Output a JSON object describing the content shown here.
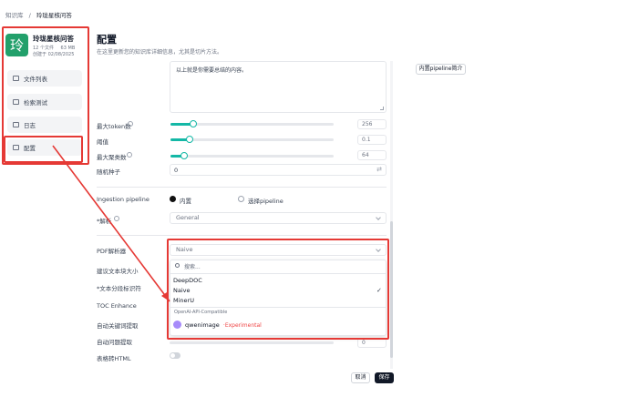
{
  "breadcrumb": {
    "root": "知识库",
    "sep": "/",
    "current": "玲珑星核问答"
  },
  "kb": {
    "avatar_char": "玲",
    "name": "玲珑星核问答",
    "meta1": "12 个文件",
    "meta2": "63 MB",
    "created": "创建于 02/08/2025",
    "avatar_color": "#22a06b"
  },
  "sidebar": {
    "items": [
      {
        "label": "文件列表"
      },
      {
        "label": "检索测试"
      },
      {
        "label": "日志"
      },
      {
        "label": "配置"
      }
    ]
  },
  "header": {
    "title": "配置",
    "subtitle": "在这里更新您的知识库详细信息，尤其是切片方法。"
  },
  "textarea": {
    "value": "以上就是你需要总结的内容。"
  },
  "pipeline_intro_button": "内置pipeline简介",
  "params": {
    "max_token_label": "最大token数",
    "max_token_value": "256",
    "threshold_label": "阈值",
    "threshold_value": "0.1",
    "max_clusters_label": "最大聚类数",
    "max_clusters_value": "64",
    "random_seed_label": "随机种子",
    "random_seed_value": "0"
  },
  "ingestion": {
    "label": "Ingestion pipeline",
    "opt_builtin": "内置",
    "opt_choose": "选择pipeline"
  },
  "parse_method": {
    "label": "*解析",
    "value": "General"
  },
  "pdf_parser": {
    "label": "PDF解析器",
    "value": "Naive"
  },
  "dropdown": {
    "search_placeholder": "搜索...",
    "options": [
      "DeepDOC",
      "Naive",
      "MinerU"
    ],
    "group_label": "OpenAI-API-Compatible",
    "model_option": "qwenimage",
    "model_tag": "Experimental"
  },
  "form_labels": {
    "chunk_size": "建议文本块大小",
    "delimiter": "*文本分段标识符",
    "toc": "TOC Enhance",
    "auto_keywords": "自动关键词提取",
    "auto_questions": "自动问题提取",
    "table_html": "表格转HTML"
  },
  "auto_questions_value": "0",
  "footer": {
    "cancel": "取消",
    "save": "保存"
  },
  "colors": {
    "accent": "#14b8a6",
    "highlight": "#e53935"
  }
}
